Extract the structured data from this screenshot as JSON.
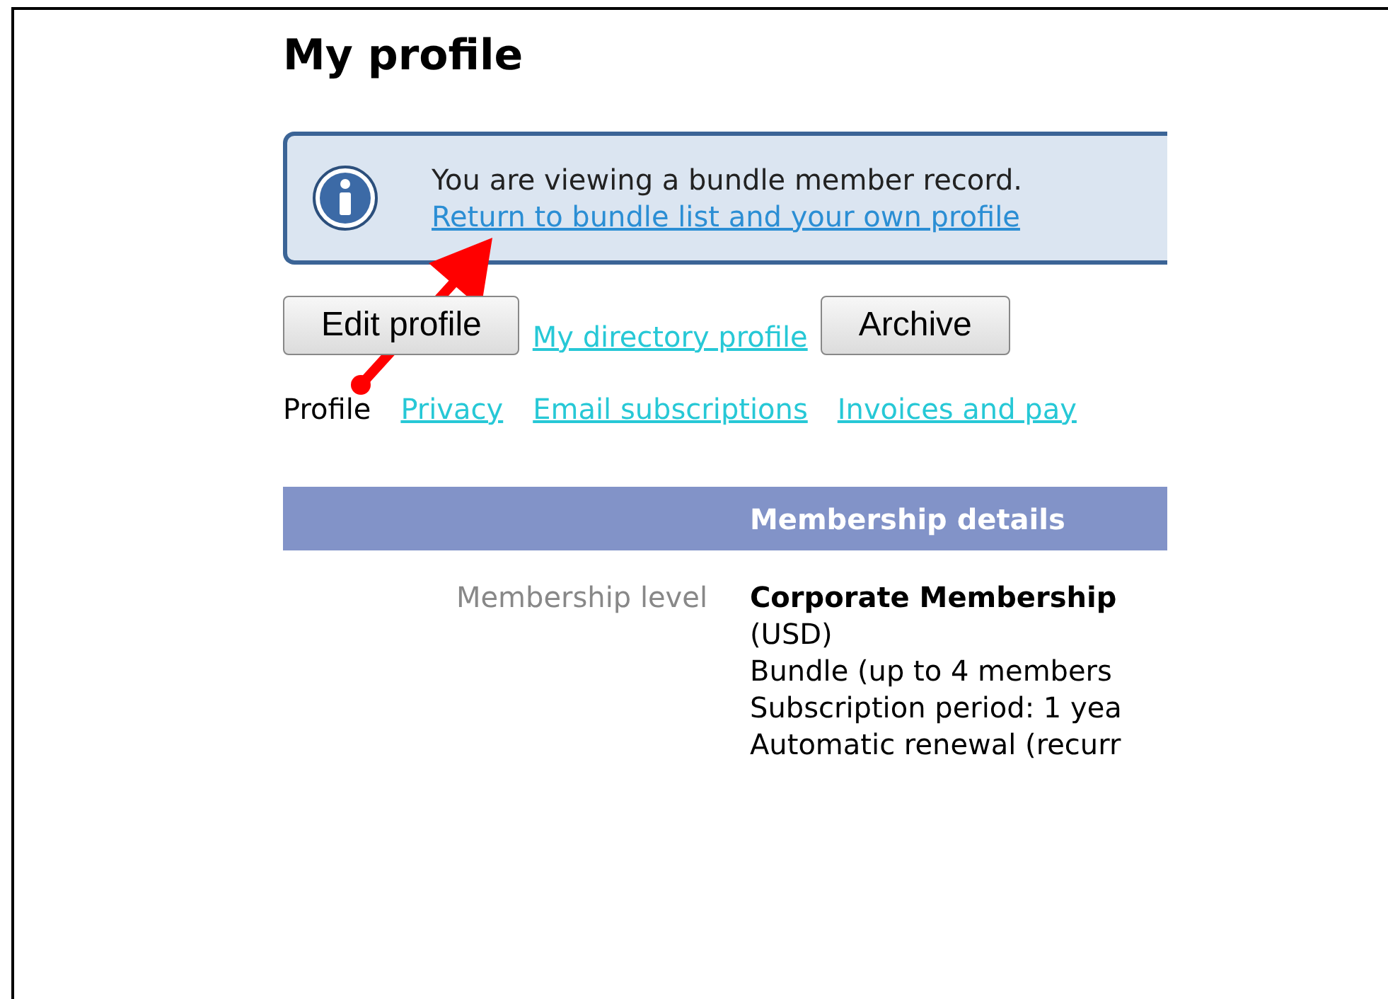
{
  "page": {
    "title": "My profile"
  },
  "notice": {
    "message": "You are viewing a bundle member record.",
    "link": "Return to bundle list and your own profile"
  },
  "actions": [
    {
      "kind": "button",
      "label": "Edit profile"
    },
    {
      "kind": "link",
      "label": "My directory profile"
    },
    {
      "kind": "button",
      "label": "Archive"
    }
  ],
  "tabs": [
    {
      "label": "Profile",
      "selected": true
    },
    {
      "label": "Privacy",
      "selected": false
    },
    {
      "label": "Email subscriptions",
      "selected": false
    },
    {
      "label": "Invoices and pay",
      "selected": false
    }
  ],
  "section": {
    "title": "Membership details",
    "rows": [
      {
        "label": "Membership level",
        "value_title": "Corporate Membership",
        "value_lines": [
          "(USD)",
          "Bundle (up to 4 members",
          "Subscription period: 1 yea",
          "Automatic renewal (recurr"
        ]
      }
    ]
  }
}
